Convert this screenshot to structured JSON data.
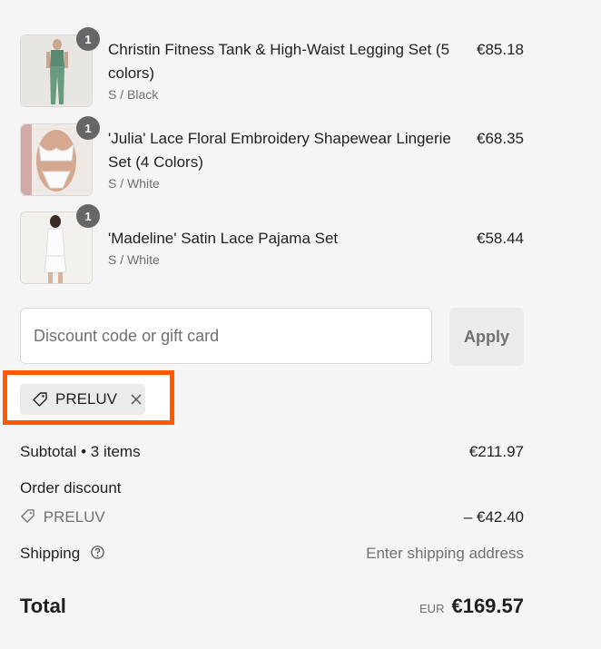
{
  "items": [
    {
      "name": "Christin Fitness Tank & High-Waist Legging Set (5 colors)",
      "variant": "S / Black",
      "price": "€85.18",
      "quantity": "1"
    },
    {
      "name": "'Julia' Lace Floral Embroidery Shapewear Lingerie Set (4 Colors)",
      "variant": "S / White",
      "price": "€68.35",
      "quantity": "1"
    },
    {
      "name": "'Madeline' Satin Lace Pajama Set",
      "variant": "S / White",
      "price": "€58.44",
      "quantity": "1"
    }
  ],
  "discount": {
    "placeholder": "Discount code or gift card",
    "value": "",
    "apply_label": "Apply",
    "applied_code": "PRELUV"
  },
  "summary": {
    "subtotal_label": "Subtotal • 3 items",
    "subtotal_value": "€211.97",
    "order_discount_label": "Order discount",
    "discount_code": "PRELUV",
    "discount_value": "– €42.40",
    "shipping_label": "Shipping",
    "shipping_value": "Enter shipping address",
    "total_label": "Total",
    "currency": "EUR",
    "total_value": "€169.57"
  },
  "colors": {
    "highlight": "#ff5a00",
    "badge": "#666666"
  }
}
